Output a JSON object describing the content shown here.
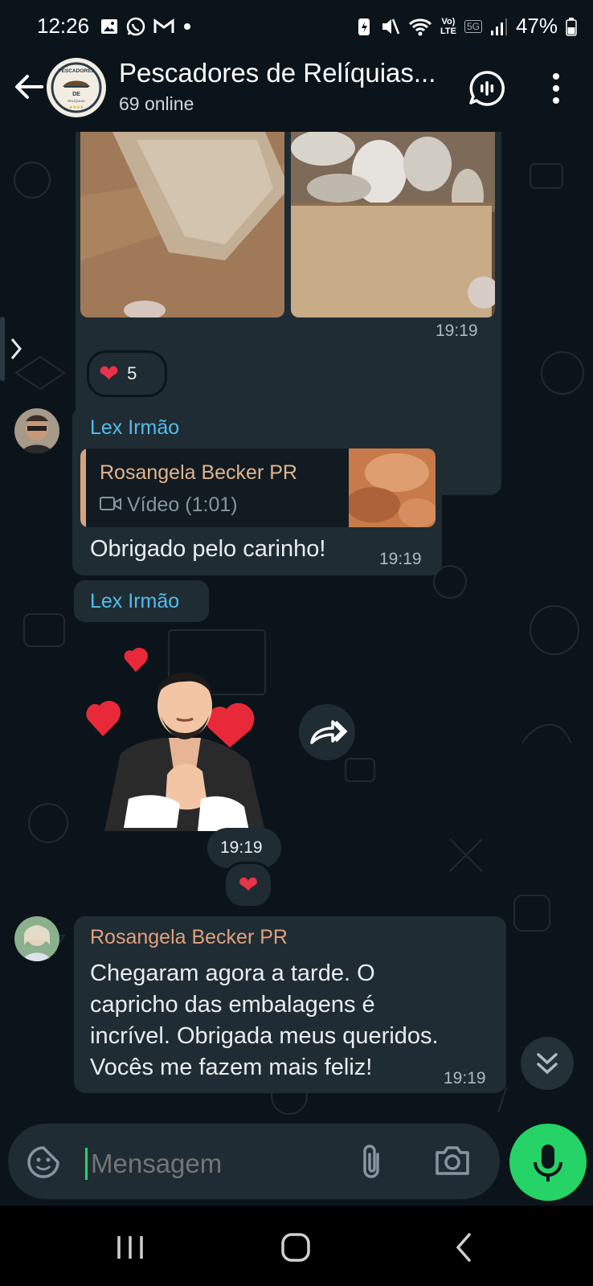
{
  "status_bar": {
    "time": "12:26",
    "battery": "47%",
    "network_label_top": "Vo)",
    "network_label_bottom": "LTE",
    "network_5g": "5G"
  },
  "header": {
    "title": "Pescadores de Relíquias...",
    "subtitle": "69 online",
    "avatar_text_top": "PESCADORES",
    "avatar_text_mid": "DE",
    "avatar_text_bottom": "RELÍQUIAS"
  },
  "messages": [
    {
      "type": "images",
      "time": "19:19",
      "reaction_emoji": "❤️",
      "reaction_count": "5"
    },
    {
      "type": "reply",
      "sender": "Lex Irmão",
      "sender_color": "#53bdeb",
      "quote_author": "Rosangela Becker PR",
      "quote_media": "Vídeo (1:01)",
      "text": "Obrigado pelo carinho!",
      "time": "19:19"
    },
    {
      "type": "sticker",
      "sender": "Lex Irmão",
      "time": "19:19",
      "reaction_emoji": "❤️"
    },
    {
      "type": "text",
      "sender": "Rosangela Becker PR",
      "sender_color": "#e0a17d",
      "lines": [
        "Chegaram agora a tarde. O",
        "capricho das embalagens é",
        "incrível. Obrigada meus queridos.",
        "Vocês me fazem mais feliz!"
      ],
      "time": "19:19"
    }
  ],
  "composer": {
    "placeholder": "Mensagem"
  },
  "colors": {
    "background": "#0b141a",
    "bubble": "#1f2c34",
    "accent": "#25d366"
  }
}
